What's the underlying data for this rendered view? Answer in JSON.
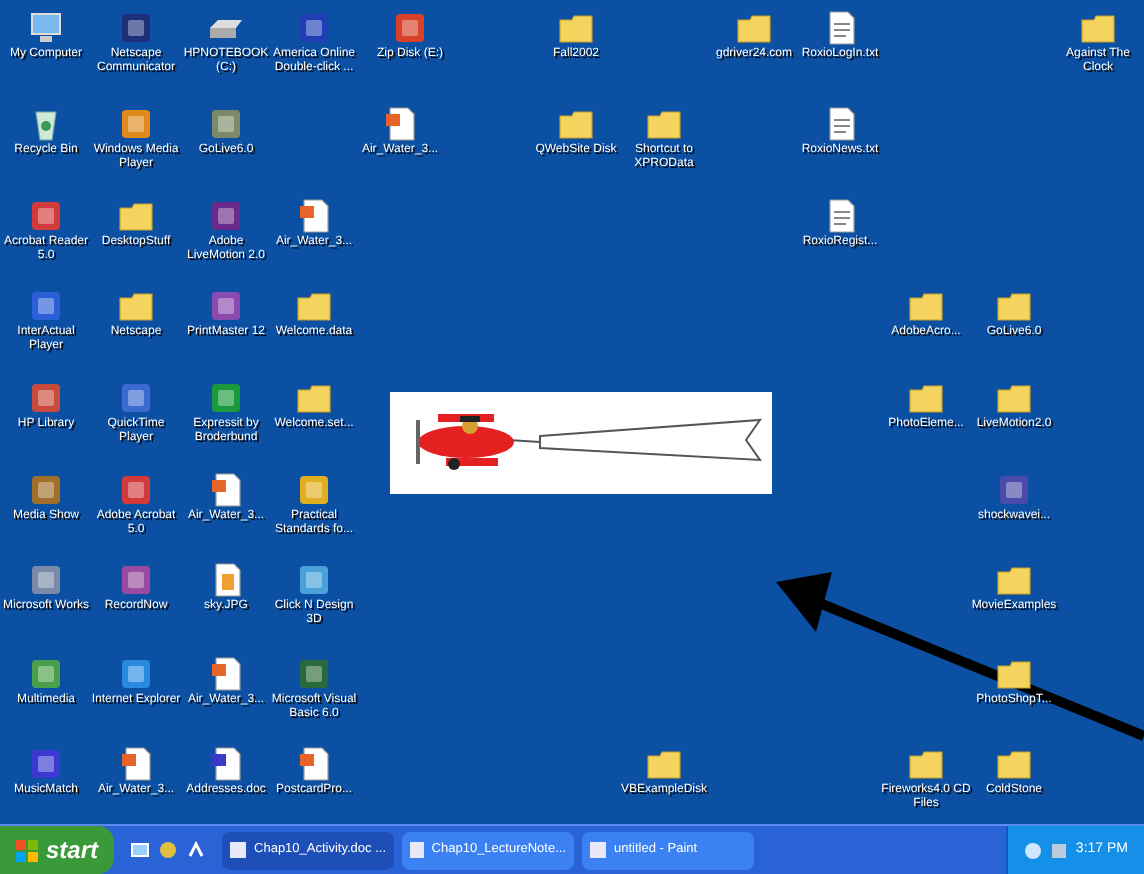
{
  "desktop_icons": [
    {
      "label": "My Computer",
      "kind": "computer"
    },
    {
      "label": "Netscape Communicator",
      "kind": "program",
      "color": "#1c2f7a"
    },
    {
      "label": "HPNOTEBOOK (C:)",
      "kind": "drive"
    },
    {
      "label": "America Online Double-click ...",
      "kind": "program",
      "color": "#1f3fb8"
    },
    {
      "label": "Zip Disk (E:)",
      "kind": "program",
      "color": "#d9412b"
    },
    {
      "label": "Fall2002",
      "kind": "folder"
    },
    {
      "label": "gdriver24.com",
      "kind": "folder"
    },
    {
      "label": "RoxioLogIn.txt",
      "kind": "text"
    },
    {
      "label": "Against The Clock",
      "kind": "folder"
    },
    {
      "label": "Recycle Bin",
      "kind": "recycle"
    },
    {
      "label": "Windows Media Player",
      "kind": "program",
      "color": "#e08a1e"
    },
    {
      "label": "GoLive6.0",
      "kind": "program",
      "color": "#7d8a6a"
    },
    {
      "label": "Air_Water_3...",
      "kind": "presentation"
    },
    {
      "label": "QWebSite Disk",
      "kind": "folder"
    },
    {
      "label": "Shortcut to XPROData",
      "kind": "folder"
    },
    {
      "label": "RoxioNews.txt",
      "kind": "text"
    },
    {
      "label": "Acrobat Reader 5.0",
      "kind": "program",
      "color": "#d23a3a"
    },
    {
      "label": "DesktopStuff",
      "kind": "folder"
    },
    {
      "label": "Adobe LiveMotion 2.0",
      "kind": "program",
      "color": "#6a2a8a"
    },
    {
      "label": "Air_Water_3...",
      "kind": "presentation"
    },
    {
      "label": "RoxioRegist...",
      "kind": "text"
    },
    {
      "label": "InterActual Player",
      "kind": "program",
      "color": "#2a5fd8"
    },
    {
      "label": "Netscape",
      "kind": "folder"
    },
    {
      "label": "PrintMaster 12",
      "kind": "program",
      "color": "#8a4ab0"
    },
    {
      "label": "Welcome.data",
      "kind": "folder"
    },
    {
      "label": "AdobeAcro...",
      "kind": "folder"
    },
    {
      "label": "GoLive6.0",
      "kind": "folder"
    },
    {
      "label": "HP Library",
      "kind": "program",
      "color": "#c84a3a"
    },
    {
      "label": "QuickTime Player",
      "kind": "program",
      "color": "#3a6ad0"
    },
    {
      "label": "Expressit by Broderbund",
      "kind": "program",
      "color": "#1a9a3a"
    },
    {
      "label": "Welcome.set...",
      "kind": "folder"
    },
    {
      "label": "PhotoEleme...",
      "kind": "folder"
    },
    {
      "label": "LiveMotion2.0",
      "kind": "folder"
    },
    {
      "label": "Media Show",
      "kind": "program",
      "color": "#a0702a"
    },
    {
      "label": "Adobe Acrobat 5.0",
      "kind": "program",
      "color": "#d23a3a"
    },
    {
      "label": "Air_Water_3...",
      "kind": "presentation"
    },
    {
      "label": "Practical Standards fo...",
      "kind": "program",
      "color": "#e0b020"
    },
    {
      "label": "shockwavei...",
      "kind": "program",
      "color": "#4a4aa8"
    },
    {
      "label": "Microsoft Works",
      "kind": "program",
      "color": "#7a8aa8"
    },
    {
      "label": "RecordNow",
      "kind": "program",
      "color": "#9a4aa0"
    },
    {
      "label": "sky.JPG",
      "kind": "image"
    },
    {
      "label": "Click N Design 3D",
      "kind": "program",
      "color": "#4aa0d8"
    },
    {
      "label": "MovieExamples",
      "kind": "folder"
    },
    {
      "label": "Multimedia",
      "kind": "program",
      "color": "#4aa04a"
    },
    {
      "label": "Internet Explorer",
      "kind": "program",
      "color": "#2a8ae0"
    },
    {
      "label": "Air_Water_3...",
      "kind": "presentation"
    },
    {
      "label": "Microsoft Visual Basic 6.0",
      "kind": "program",
      "color": "#2a6a3a"
    },
    {
      "label": "PhotoShopT...",
      "kind": "folder"
    },
    {
      "label": "MusicMatch",
      "kind": "program",
      "color": "#3a3ad0"
    },
    {
      "label": "Air_Water_3...",
      "kind": "presentation"
    },
    {
      "label": "Addresses.doc",
      "kind": "document"
    },
    {
      "label": "PostcardPro...",
      "kind": "presentation"
    },
    {
      "label": "VBExampleDisk",
      "kind": "folder"
    },
    {
      "label": "Fireworks4.0 CD Files",
      "kind": "folder"
    },
    {
      "label": "ColdStone",
      "kind": "folder"
    }
  ],
  "taskbar": {
    "start": "start",
    "tasks": [
      {
        "label": "Chap10_Activity.doc ...",
        "selected": true
      },
      {
        "label": "Chap10_LectureNote...",
        "selected": false
      },
      {
        "label": "untitled - Paint",
        "selected": false
      }
    ],
    "clock": "3:17 PM"
  }
}
